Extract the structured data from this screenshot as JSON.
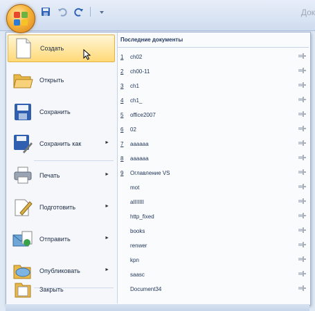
{
  "title_bar": {
    "title": "Док"
  },
  "menu": {
    "items": [
      {
        "label": "Создать",
        "icon": "new-document-icon",
        "submenu": false
      },
      {
        "label": "Открыть",
        "icon": "open-folder-icon",
        "submenu": false
      },
      {
        "label": "Сохранить",
        "icon": "save-disk-icon",
        "submenu": false
      },
      {
        "label": "Сохранить как",
        "icon": "save-as-icon",
        "submenu": true
      },
      {
        "label": "Печать",
        "icon": "printer-icon",
        "submenu": true
      },
      {
        "label": "Подготовить",
        "icon": "prepare-icon",
        "submenu": true
      },
      {
        "label": "Отправить",
        "icon": "send-icon",
        "submenu": true
      },
      {
        "label": "Опубликовать",
        "icon": "publish-icon",
        "submenu": true
      },
      {
        "label": "Закрыть",
        "icon": "close-folder-icon",
        "submenu": false
      }
    ]
  },
  "recent": {
    "title": "Последние документы",
    "documents": [
      {
        "num": "1",
        "name": "ch02"
      },
      {
        "num": "2",
        "name": "ch00-11"
      },
      {
        "num": "3",
        "name": "ch1"
      },
      {
        "num": "4",
        "name": "ch1_"
      },
      {
        "num": "5",
        "name": "office2007"
      },
      {
        "num": "6",
        "name": "02"
      },
      {
        "num": "7",
        "name": "аааааа"
      },
      {
        "num": "8",
        "name": "аааааа"
      },
      {
        "num": "9",
        "name": "Оглавление VS"
      },
      {
        "num": "",
        "name": "mot"
      },
      {
        "num": "",
        "name": "aIIIIIII"
      },
      {
        "num": "",
        "name": "http_fixed"
      },
      {
        "num": "",
        "name": "books"
      },
      {
        "num": "",
        "name": "renwer"
      },
      {
        "num": "",
        "name": "kpn"
      },
      {
        "num": "",
        "name": "saasc"
      },
      {
        "num": "",
        "name": "Document34"
      }
    ]
  }
}
